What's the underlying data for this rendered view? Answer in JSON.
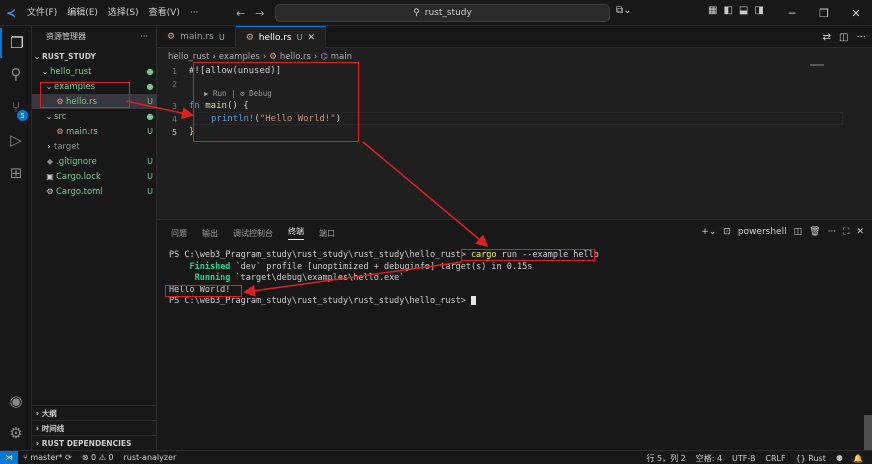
{
  "titlebar": {
    "menus": [
      "文件(F)",
      "编辑(E)",
      "选择(S)",
      "查看(V)",
      "···"
    ],
    "search_text": "rust_study"
  },
  "sidebar": {
    "title": "资源管理器",
    "more": "···",
    "project": "RUST_STUDY",
    "tree": [
      {
        "label": "hello_rust",
        "status": "●"
      },
      {
        "label": "examples",
        "status": "●"
      },
      {
        "label": "hello.rs",
        "status": "U"
      },
      {
        "label": "src",
        "status": "●"
      },
      {
        "label": "main.rs",
        "status": "U"
      },
      {
        "label": "target",
        "status": ""
      },
      {
        "label": ".gitignore",
        "status": "U"
      },
      {
        "label": "Cargo.lock",
        "status": "U"
      },
      {
        "label": "Cargo.toml",
        "status": "U"
      }
    ],
    "sections": [
      "大纲",
      "时间线",
      "RUST DEPENDENCIES"
    ]
  },
  "tabs": [
    {
      "label": "main.rs",
      "mod": "U"
    },
    {
      "label": "hello.rs",
      "mod": "U"
    }
  ],
  "breadcrumb": [
    "hello_rust",
    "examples",
    "hello.rs",
    "main"
  ],
  "editor": {
    "line_numbers": [
      "1",
      "2",
      "3",
      "4",
      "5"
    ],
    "codelens": "▶ Run | ⚙ Debug",
    "attr_line": "#![allow(unused)]",
    "fn_kw": "fn",
    "fn_name": "main",
    "fn_rest": "() {",
    "macro": "println!",
    "str": "\"Hello World!\"",
    "tail": ")",
    "close": "}"
  },
  "panel": {
    "tabs": [
      "问题",
      "输出",
      "调试控制台",
      "终端",
      "端口"
    ],
    "active_tab": "终端",
    "shell": "powershell"
  },
  "terminal": {
    "prompt1": "PS C:\\web3_Pragram_study\\rust_study\\rust_study\\hello_rust>",
    "cmd_cargo": "cargo",
    "cmd_rest": "run --example hello",
    "finished_word": "Finished",
    "finished_rest": "`dev` profile [unoptimized + debuginfo] target(s) in 0.15s",
    "running_word": "Running",
    "running_rest": "`target\\debug\\examples\\hello.exe`",
    "output": "Hello World!",
    "prompt2": "PS C:\\web3_Pragram_study\\rust_study\\rust_study\\hello_rust>"
  },
  "status": {
    "branch": "master*",
    "problems": "⊗ 0 ⚠ 0",
    "analyzer": "rust-analyzer",
    "position": "行 5，列 2",
    "spaces": "空格: 4",
    "encoding": "UTF-8",
    "eol": "CRLF",
    "lang": "{} Rust"
  }
}
